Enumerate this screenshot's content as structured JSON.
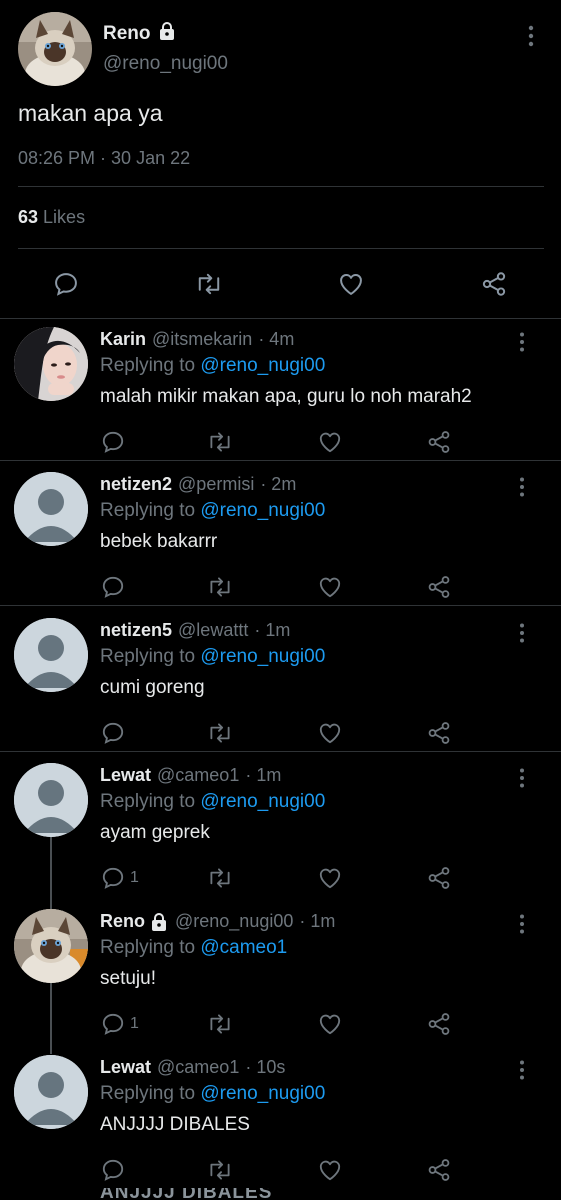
{
  "main_tweet": {
    "name": "Reno",
    "handle": "@reno_nugi00",
    "text": "makan apa ya",
    "time": "08:26 PM · 30 Jan 22",
    "likes_count": "63",
    "likes_label": "Likes"
  },
  "replies": [
    {
      "name": "Karin",
      "handle": "@itsmekarin",
      "time": "· 4m",
      "replying_prefix": "Replying to",
      "replying_to": "@reno_nugi00",
      "text": "malah mikir makan apa, guru lo noh marah2",
      "reply_count": "",
      "locked": false
    },
    {
      "name": "netizen2",
      "handle": "@permisi",
      "time": "· 2m",
      "replying_prefix": "Replying to",
      "replying_to": "@reno_nugi00",
      "text": "bebek bakarrr",
      "reply_count": "",
      "locked": false
    },
    {
      "name": "netizen5",
      "handle": "@lewattt",
      "time": "· 1m",
      "replying_prefix": "Replying to",
      "replying_to": "@reno_nugi00",
      "text": "cumi goreng",
      "reply_count": "",
      "locked": false
    },
    {
      "name": "Lewat",
      "handle": "@cameo1",
      "time": "· 1m",
      "replying_prefix": "Replying to",
      "replying_to": "@reno_nugi00",
      "text": "ayam geprek",
      "reply_count": "1",
      "locked": false
    },
    {
      "name": "Reno",
      "handle": "@reno_nugi00",
      "time": "· 1m",
      "replying_prefix": "Replying to",
      "replying_to": "@cameo1",
      "text": "setuju!",
      "reply_count": "1",
      "locked": true
    },
    {
      "name": "Lewat",
      "handle": "@cameo1",
      "time": "· 10s",
      "replying_prefix": "Replying to",
      "replying_to": "@reno_nugi00",
      "text": "ANJJJJ DIBALES",
      "reply_count": "",
      "locked": false
    }
  ],
  "bottom_partial_text": "ANJJJJ DIBALES",
  "colors": {
    "background": "#000000",
    "text": "#e7e9ea",
    "muted": "#6e767d",
    "link": "#1d9bf0",
    "divider": "#2f3336"
  }
}
